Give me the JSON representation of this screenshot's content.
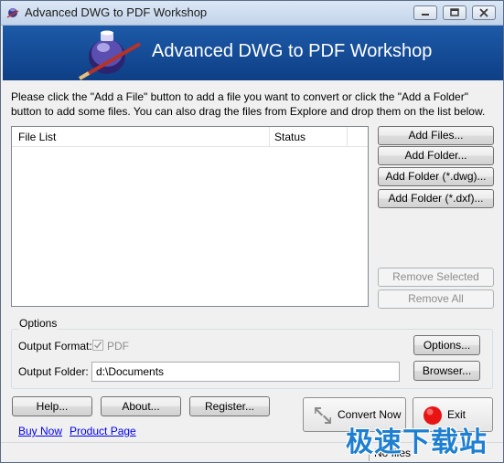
{
  "window": {
    "title": "Advanced DWG to PDF Workshop",
    "controls": [
      "minimize",
      "maximize",
      "close"
    ]
  },
  "banner": {
    "title": "Advanced DWG to PDF Workshop"
  },
  "instructions": "Please click the \"Add a File\" button to add a file you want to convert or click the \"Add a Folder\" button to add some files. You can also drag the files from Explore and drop them on the list below.",
  "file_list": {
    "columns": [
      "File List",
      "Status"
    ],
    "rows": []
  },
  "side_buttons": {
    "add_files": "Add Files...",
    "add_folder": "Add Folder...",
    "add_folder_dwg": "Add Folder (*.dwg)...",
    "add_folder_dxf": "Add Folder (*.dxf)...",
    "remove_selected": "Remove Selected",
    "remove_all": "Remove All"
  },
  "options": {
    "legend": "Options",
    "output_format_label": "Output Format:",
    "output_format_value": "PDF",
    "output_format_checked": true,
    "output_folder_label": "Output Folder:",
    "output_folder_value": "d:\\Documents",
    "options_button": "Options...",
    "browser_button": "Browser..."
  },
  "bottom_buttons": {
    "help": "Help...",
    "about": "About...",
    "register": "Register..."
  },
  "links": {
    "buy_now": "Buy Now",
    "product_page": "Product Page"
  },
  "actions": {
    "convert_now": "Convert Now",
    "exit": "Exit"
  },
  "status": {
    "text": "No files"
  },
  "watermark": "极速下载站",
  "colors": {
    "banner": "#1d5aa8",
    "link": "#0000ee",
    "exit_icon": "#e81414",
    "watermark": "#1e7fd0"
  }
}
